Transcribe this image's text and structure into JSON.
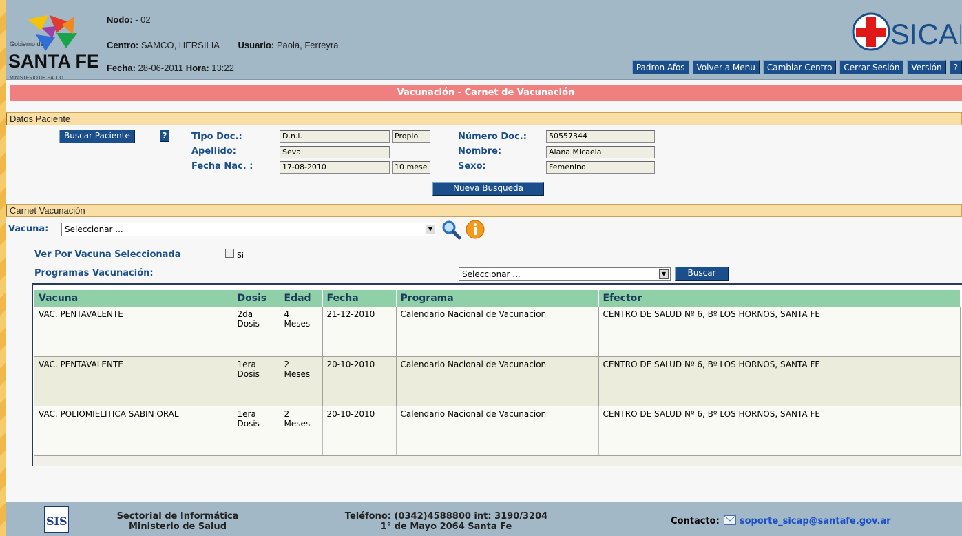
{
  "header": {
    "logo": {
      "line1": "Gobierno de",
      "line2": "SANTA FE",
      "line3": "MINISTERIO DE SALUD"
    },
    "nodo_label": "Nodo:",
    "nodo_value": "- 02",
    "centro_label": "Centro:",
    "centro_value": "SAMCO, HERSILIA",
    "usuario_label": "Usuario:",
    "usuario_value": "Paola, Ferreyra",
    "fecha_label": "Fecha:",
    "fecha_value": "28-06-2011",
    "hora_label": "Hora:",
    "hora_value": "13:22",
    "brand": "SICAP",
    "nav": [
      "Padron Afos",
      "Volver a Menu",
      "Cambiar Centro",
      "Cerrar Sesión",
      "Versión",
      "?"
    ]
  },
  "title": "Vacunación - Carnet de Vacunación",
  "datos_paciente": {
    "section": "Datos Paciente",
    "buscar_btn": "Buscar Paciente",
    "help": "?",
    "tipo_doc_label": "Tipo Doc.:",
    "tipo_doc": "D.n.i.",
    "tipo_doc_extra": "Propio",
    "apellido_label": "Apellido:",
    "apellido": "Seval",
    "fecha_nac_label": "Fecha Nac. :",
    "fecha_nac": "17-08-2010",
    "edad": "10 mese",
    "numero_doc_label": "Número Doc.:",
    "numero_doc": "50557344",
    "nombre_label": "Nombre:",
    "nombre": "Alana Micaela",
    "sexo_label": "Sexo:",
    "sexo": "Femenino",
    "nueva_busqueda": "Nueva Busqueda"
  },
  "carnet": {
    "section": "Carnet Vacunación",
    "vacuna_label": "Vacuna:",
    "vacuna_select": "Seleccionar ...",
    "ver_por_label": "Ver Por Vacuna Seleccionada",
    "si_label": "Si",
    "programas_label": "Programas Vacunación:",
    "programas_select": "Seleccionar ...",
    "buscar_btn": "Buscar"
  },
  "table": {
    "headers": [
      "Vacuna",
      "Dosis",
      "Edad",
      "Fecha",
      "Programa",
      "Efector"
    ],
    "rows": [
      {
        "vacuna": "VAC. PENTAVALENTE",
        "dosis": "2da Dosis",
        "edad": "4 Meses",
        "fecha": "21-12-2010",
        "programa": "Calendario Nacional de Vacunacion",
        "efector": "CENTRO DE SALUD Nº 6, Bº LOS HORNOS, SANTA FE"
      },
      {
        "vacuna": "VAC. PENTAVALENTE",
        "dosis": "1era Dosis",
        "edad": "2 Meses",
        "fecha": "20-10-2010",
        "programa": "Calendario Nacional de Vacunacion",
        "efector": "CENTRO DE SALUD Nº 6, Bº LOS HORNOS, SANTA FE"
      },
      {
        "vacuna": "VAC. POLIOMIELITICA SABIN ORAL",
        "dosis": "1era Dosis",
        "edad": "2 Meses",
        "fecha": "20-10-2010",
        "programa": "Calendario Nacional de Vacunacion",
        "efector": "CENTRO DE SALUD Nº 6, Bº LOS HORNOS, SANTA FE"
      }
    ]
  },
  "footer": {
    "sis_logo": "SIS",
    "sectorial_line1": "Sectorial de Informática",
    "sectorial_line2": "Ministerio de Salud",
    "telefono_line1": "Teléfono: (0342)4588800 int: 3190/3204",
    "telefono_line2": "1° de Mayo 2064 Santa Fe",
    "contacto_label": "Contacto:",
    "contacto_email": "soporte_sicap@santafe.gov.ar"
  },
  "colors": {
    "header_bg": "#a3b8c6",
    "title_bar": "#f08080",
    "nav_btn": "#1a4f8c",
    "table_header": "#8fd0a8"
  }
}
